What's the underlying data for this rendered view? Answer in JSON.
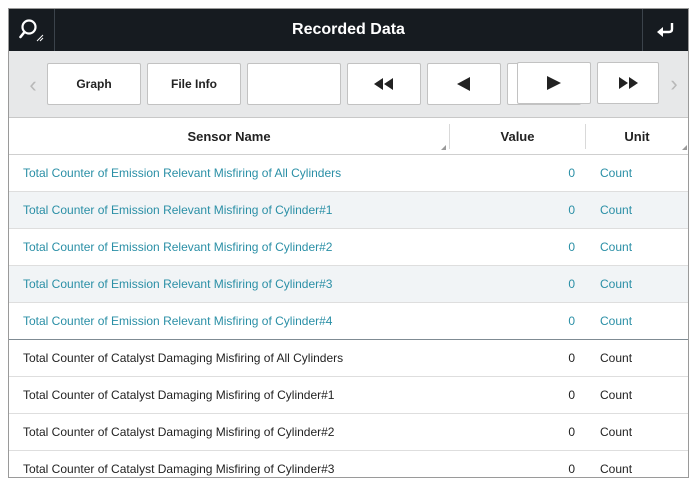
{
  "window": {
    "title": "Recorded Data"
  },
  "icons": {
    "search": "search-icon",
    "back": "return-icon"
  },
  "toolbar": {
    "graph_label": "Graph",
    "file_info_label": "File Info",
    "blank_label": "",
    "prev_arrow": "‹",
    "next_arrow": "›"
  },
  "table": {
    "headers": {
      "name": "Sensor Name",
      "value": "Value",
      "unit": "Unit"
    },
    "rows": [
      {
        "name": "Total Counter of Emission Relevant Misfiring of All Cylinders",
        "value": "0",
        "unit": "Count"
      },
      {
        "name": "Total Counter of Emission Relevant Misfiring of Cylinder#1",
        "value": "0",
        "unit": "Count"
      },
      {
        "name": "Total Counter of Emission Relevant Misfiring of Cylinder#2",
        "value": "0",
        "unit": "Count"
      },
      {
        "name": "Total Counter of Emission Relevant Misfiring of Cylinder#3",
        "value": "0",
        "unit": "Count"
      },
      {
        "name": "Total Counter of Emission Relevant Misfiring of Cylinder#4",
        "value": "0",
        "unit": "Count"
      },
      {
        "name": "Total Counter of Catalyst Damaging Misfiring of All Cylinders",
        "value": "0",
        "unit": "Count"
      },
      {
        "name": "Total Counter of Catalyst Damaging Misfiring of Cylinder#1",
        "value": "0",
        "unit": "Count"
      },
      {
        "name": "Total Counter of Catalyst Damaging Misfiring of Cylinder#2",
        "value": "0",
        "unit": "Count"
      },
      {
        "name": "Total Counter of Catalyst Damaging Misfiring of Cylinder#3",
        "value": "0",
        "unit": "Count"
      }
    ]
  },
  "colors": {
    "titlebar": "#161b20",
    "highlight_text": "#2a8fa6",
    "toolbar_bg": "#e7e8e9",
    "alt_row": "#f1f4f6"
  }
}
